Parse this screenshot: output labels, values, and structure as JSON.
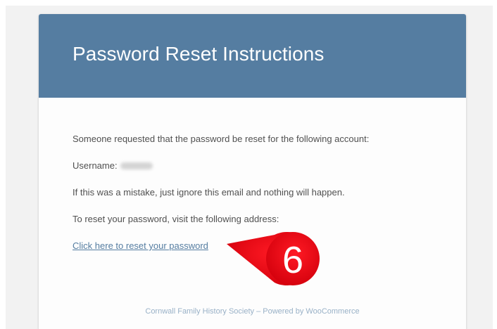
{
  "email": {
    "title": "Password Reset Instructions",
    "body": {
      "line_request": "Someone requested that the password be reset for the following account:",
      "username_label": "Username:",
      "line_mistake": "If this was a mistake, just ignore this email and nothing will happen.",
      "line_visit": "To reset your password, visit the following address:",
      "reset_link_text": "Click here to reset your password"
    },
    "footer": "Cornwall Family History Society – Powered by WooCommerce"
  },
  "callout": {
    "number": "6"
  },
  "colors": {
    "header_bg": "#557da1",
    "link": "#557da1",
    "callout": "#e8000e",
    "footer_text": "#99b1c7"
  }
}
